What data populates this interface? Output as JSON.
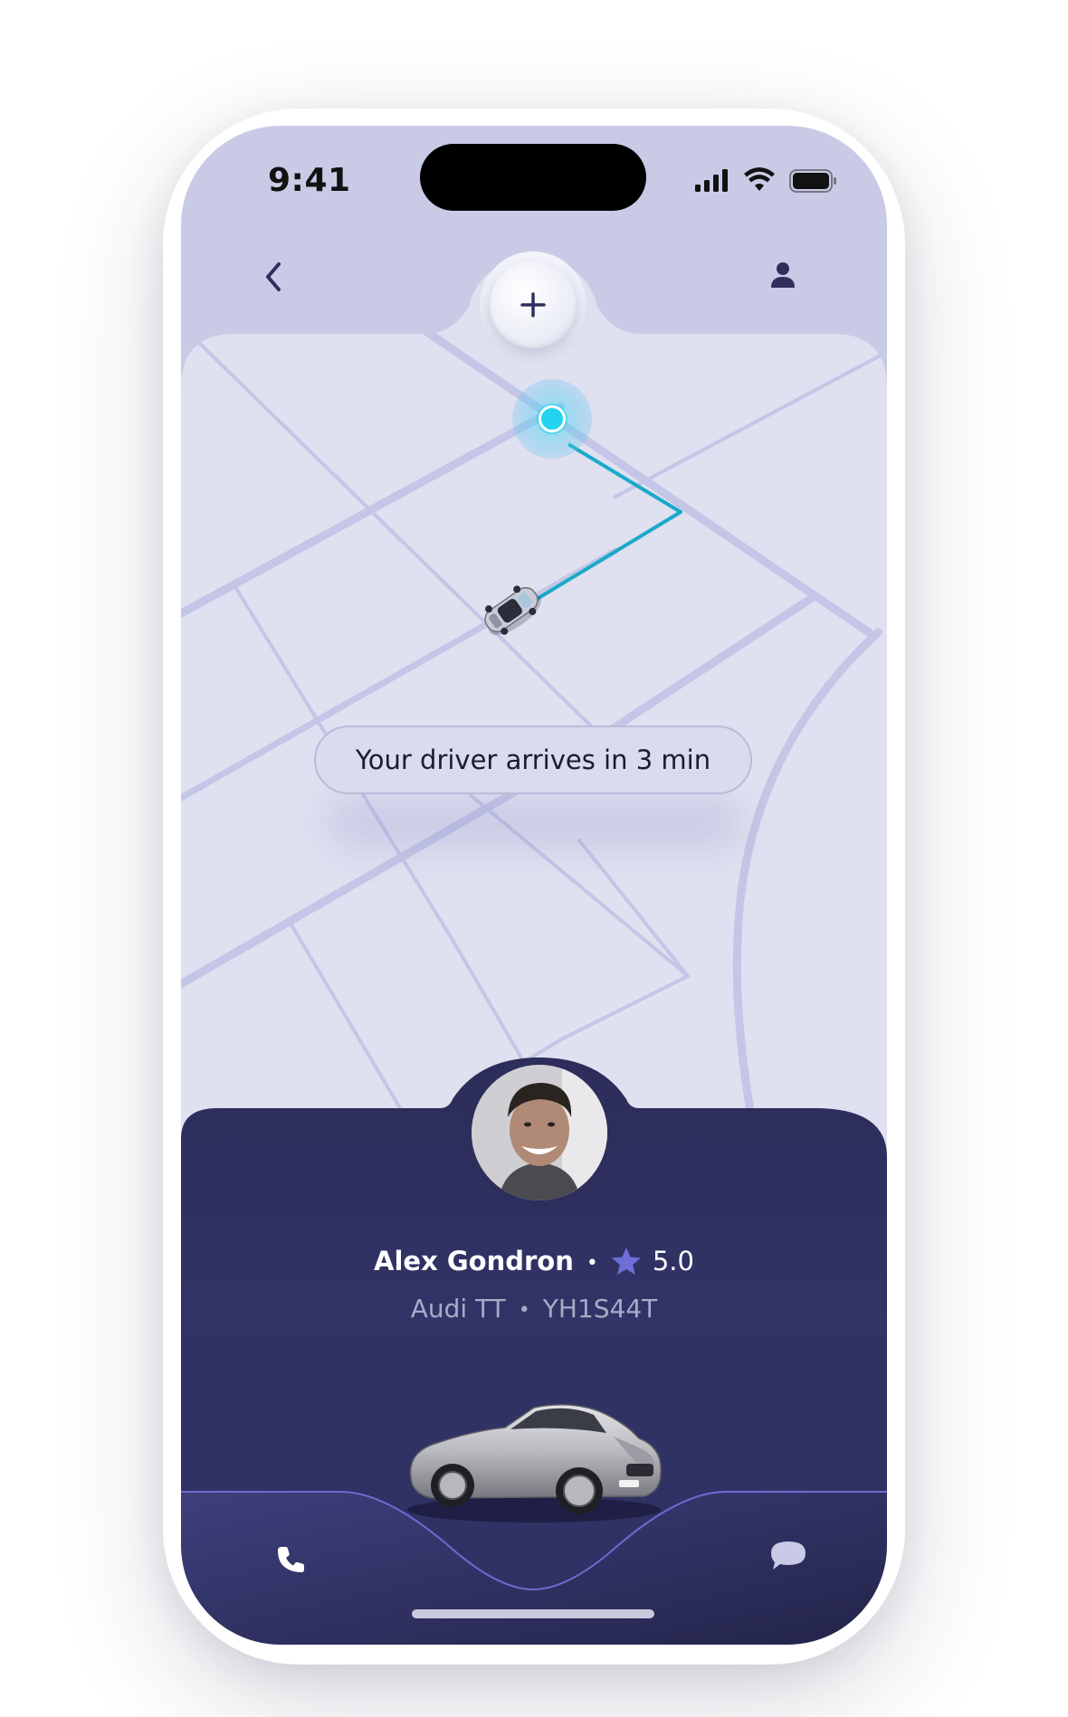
{
  "status_bar": {
    "time": "9:41"
  },
  "header": {
    "back_icon": "chevron-left-icon",
    "add_icon": "plus-icon",
    "profile_icon": "person-icon"
  },
  "map": {
    "eta_message": "Your driver arrives in 3 min",
    "route_color": "#1aa9c9",
    "pin_color": "#24d3f0"
  },
  "driver": {
    "name": "Alex Gondron",
    "rating": "5.0",
    "rating_icon": "star-icon",
    "car_model": "Audi TT",
    "plate": "YH1S44T"
  },
  "actions": {
    "call_icon": "phone-icon",
    "chat_icon": "chat-bubble-icon"
  },
  "colors": {
    "sheet": "#2f2f5e",
    "map_bg": "#dfe0f0",
    "header_bg": "#c9cbe6",
    "accent_star": "#6d6fd6"
  }
}
